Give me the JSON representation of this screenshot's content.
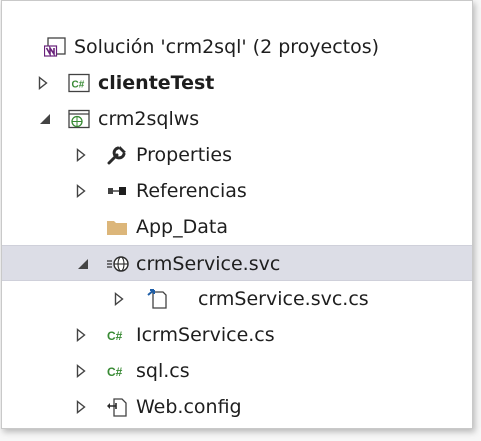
{
  "tree": {
    "solution": {
      "label": "Solución 'crm2sql'  (2 proyectos)",
      "icon": "solution-icon"
    },
    "items": [
      {
        "label": "clienteTest",
        "icon": "csharp-project-icon"
      },
      {
        "label": "crm2sqlws",
        "icon": "web-project-icon"
      },
      {
        "label": "Properties",
        "icon": "wrench-icon"
      },
      {
        "label": "Referencias",
        "icon": "references-icon"
      },
      {
        "label": "App_Data",
        "icon": "folder-icon"
      },
      {
        "label": "crmService.svc",
        "icon": "web-service-icon"
      },
      {
        "label": "crmService.svc.cs",
        "icon": "code-behind-icon"
      },
      {
        "label": "IcrmService.cs",
        "icon": "csharp-file-icon"
      },
      {
        "label": "sql.cs",
        "icon": "csharp-file-icon"
      },
      {
        "label": "Web.config",
        "icon": "config-file-icon"
      }
    ]
  },
  "colors": {
    "selection": "#dcdde6",
    "vs_purple": "#68217a",
    "csharp_green": "#388a34",
    "folder": "#dcb67a",
    "arrow": "#444444"
  }
}
